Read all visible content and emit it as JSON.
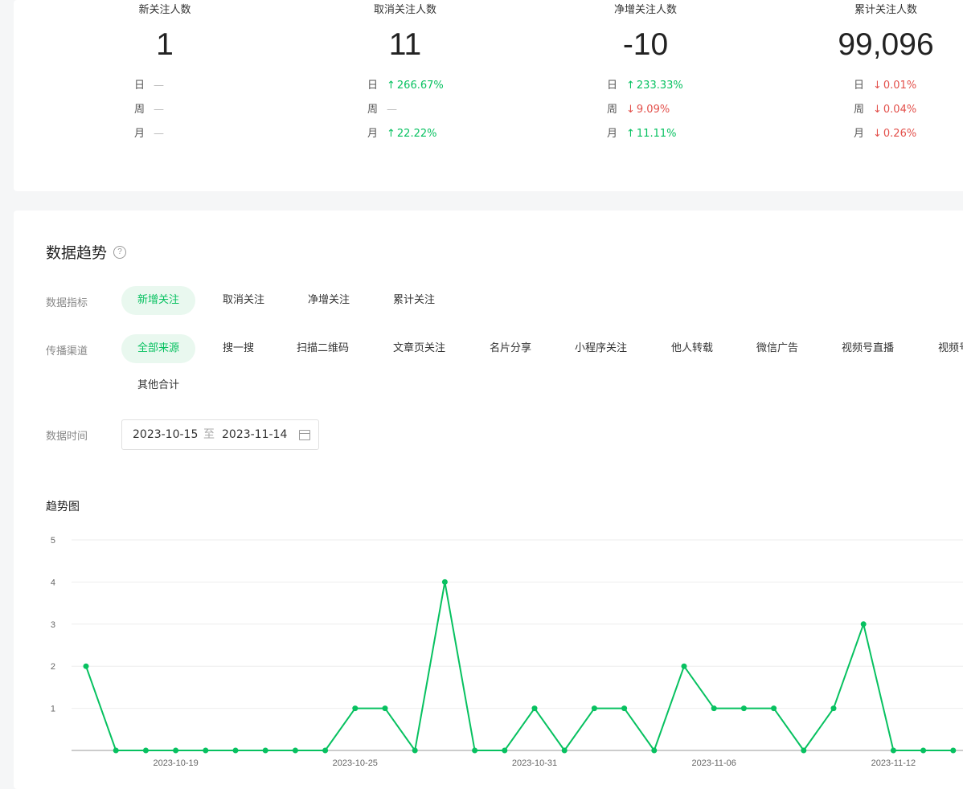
{
  "stats": [
    {
      "label": "新关注人数",
      "value": "1",
      "cmp": [
        {
          "key": "日",
          "arrow": "",
          "text": "—",
          "dir": "flat"
        },
        {
          "key": "周",
          "arrow": "",
          "text": "—",
          "dir": "flat"
        },
        {
          "key": "月",
          "arrow": "",
          "text": "—",
          "dir": "flat"
        }
      ]
    },
    {
      "label": "取消关注人数",
      "value": "11",
      "cmp": [
        {
          "key": "日",
          "arrow": "↑",
          "text": "266.67%",
          "dir": "up"
        },
        {
          "key": "周",
          "arrow": "",
          "text": "—",
          "dir": "flat"
        },
        {
          "key": "月",
          "arrow": "↑",
          "text": "22.22%",
          "dir": "up"
        }
      ]
    },
    {
      "label": "净增关注人数",
      "value": "-10",
      "cmp": [
        {
          "key": "日",
          "arrow": "↑",
          "text": "233.33%",
          "dir": "up"
        },
        {
          "key": "周",
          "arrow": "↓",
          "text": "9.09%",
          "dir": "down"
        },
        {
          "key": "月",
          "arrow": "↑",
          "text": "11.11%",
          "dir": "up"
        }
      ]
    },
    {
      "label": "累计关注人数",
      "value": "99,096",
      "cmp": [
        {
          "key": "日",
          "arrow": "↓",
          "text": "0.01%",
          "dir": "down"
        },
        {
          "key": "周",
          "arrow": "↓",
          "text": "0.04%",
          "dir": "down"
        },
        {
          "key": "月",
          "arrow": "↓",
          "text": "0.26%",
          "dir": "down"
        }
      ]
    }
  ],
  "trend": {
    "title": "数据趋势",
    "help_icon": "question-circle-icon",
    "metric_label": "数据指标",
    "metrics": [
      "新增关注",
      "取消关注",
      "净增关注",
      "累计关注"
    ],
    "active_metric": 0,
    "channel_label": "传播渠道",
    "channels": [
      "全部来源",
      "搜一搜",
      "扫描二维码",
      "文章页关注",
      "名片分享",
      "小程序关注",
      "他人转载",
      "微信广告",
      "视频号直播",
      "视频号",
      "其他合计"
    ],
    "active_channel": 0,
    "date_label": "数据时间",
    "date_start": "2023-10-15",
    "date_sep": "至",
    "date_end": "2023-11-14",
    "calendar_icon": "calendar-icon",
    "chart_title": "趋势图"
  },
  "colors": {
    "accent": "#07c160",
    "down": "#e3504b"
  },
  "chart_data": {
    "type": "line",
    "title": "趋势图",
    "ylim": [
      0,
      5
    ],
    "yticks": [
      1,
      2,
      3,
      4,
      5
    ],
    "x": [
      "2023-10-16",
      "2023-10-17",
      "2023-10-18",
      "2023-10-19",
      "2023-10-20",
      "2023-10-21",
      "2023-10-22",
      "2023-10-23",
      "2023-10-24",
      "2023-10-25",
      "2023-10-26",
      "2023-10-27",
      "2023-10-28",
      "2023-10-29",
      "2023-10-30",
      "2023-10-31",
      "2023-11-01",
      "2023-11-02",
      "2023-11-03",
      "2023-11-04",
      "2023-11-05",
      "2023-11-06",
      "2023-11-07",
      "2023-11-08",
      "2023-11-09",
      "2023-11-10",
      "2023-11-11",
      "2023-11-12",
      "2023-11-13",
      "2023-11-14"
    ],
    "values": [
      2,
      0,
      0,
      0,
      0,
      0,
      0,
      0,
      0,
      1,
      1,
      0,
      4,
      0,
      0,
      1,
      0,
      1,
      1,
      0,
      2,
      1,
      1,
      1,
      0,
      1,
      3,
      0,
      0,
      0
    ],
    "xtick_labels": [
      "2023-10-19",
      "2023-10-25",
      "2023-10-31",
      "2023-11-06",
      "2023-11-12"
    ],
    "grid": true
  }
}
